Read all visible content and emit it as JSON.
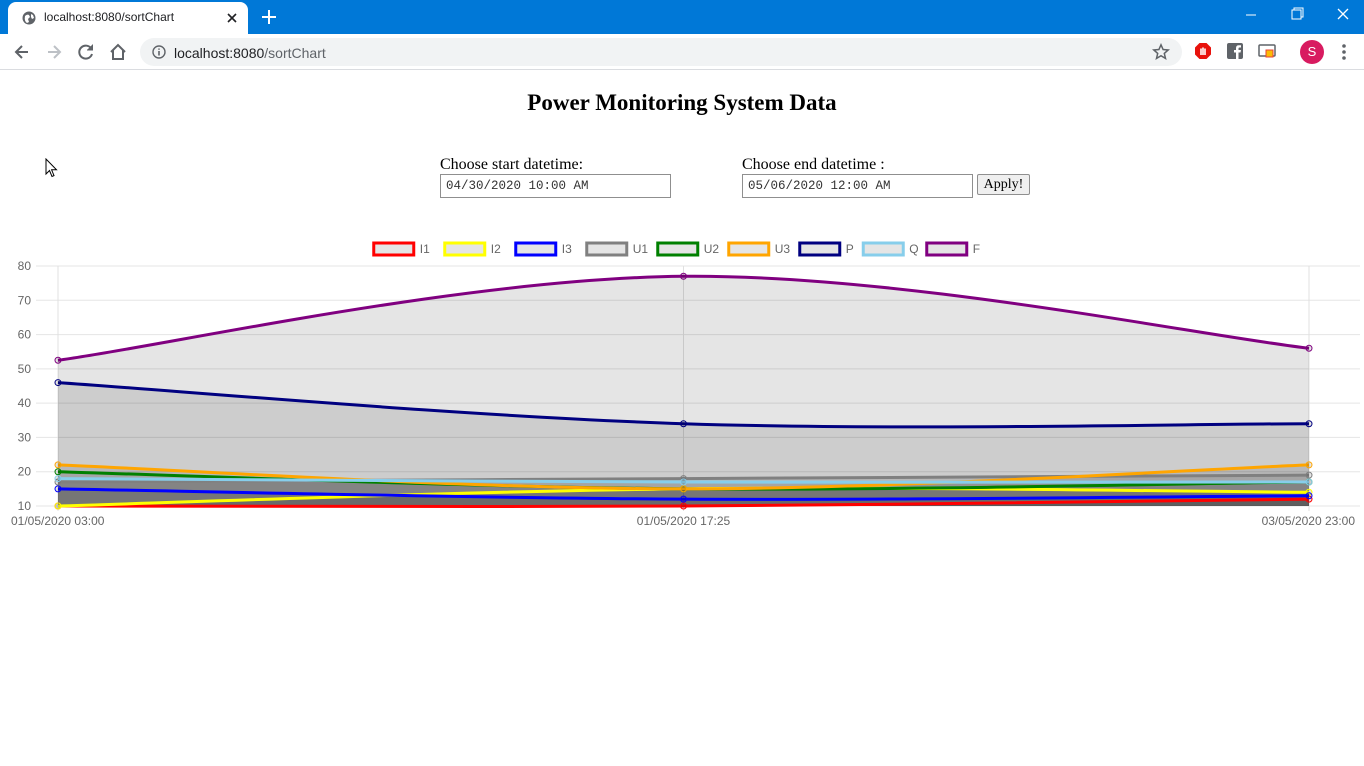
{
  "browser": {
    "tab_title": "localhost:8080/sortChart",
    "url_host": "localhost:8080",
    "url_path": "/sortChart",
    "profile_initial": "S"
  },
  "page": {
    "title": "Power Monitoring System Data",
    "start_label": "Choose start datetime:",
    "start_value": "04/30/2020 10:00 AM",
    "end_label": "Choose end datetime :",
    "end_value": "05/06/2020 12:00 AM",
    "apply_label": "Apply!"
  },
  "chart_data": {
    "type": "line",
    "categories": [
      "01/05/2020 03:00",
      "01/05/2020 17:25",
      "03/05/2020 23:00"
    ],
    "ylim": [
      10,
      80
    ],
    "yticks": [
      10,
      20,
      30,
      40,
      50,
      60,
      70,
      80
    ],
    "grid": true,
    "legend_position": "top",
    "series": [
      {
        "name": "I1",
        "color": "#ff0000",
        "values": [
          10,
          10,
          12
        ]
      },
      {
        "name": "I2",
        "color": "#ffff00",
        "values": [
          10,
          15,
          14
        ]
      },
      {
        "name": "I3",
        "color": "#0000ff",
        "values": [
          15,
          12,
          13
        ]
      },
      {
        "name": "U1",
        "color": "#808080",
        "values": [
          17,
          18,
          19
        ]
      },
      {
        "name": "U2",
        "color": "#008000",
        "values": [
          20,
          15,
          17
        ]
      },
      {
        "name": "U3",
        "color": "#ffa500",
        "values": [
          22,
          15,
          22
        ]
      },
      {
        "name": "P",
        "color": "#000080",
        "values": [
          46,
          34,
          34
        ]
      },
      {
        "name": "Q",
        "color": "#87ceeb",
        "values": [
          18,
          17,
          17
        ]
      },
      {
        "name": "F",
        "color": "#800080",
        "values": [
          52.5,
          77,
          56
        ]
      }
    ]
  }
}
